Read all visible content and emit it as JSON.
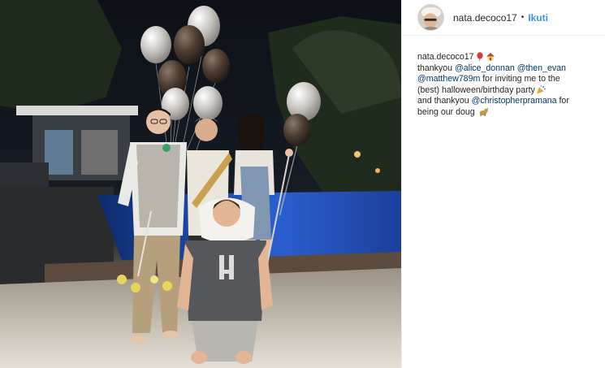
{
  "post": {
    "username": "nata.decoco17",
    "separator": "•",
    "follow_label": "Ikuti"
  },
  "caption": {
    "username": "nata.decoco17",
    "lines": [
      {
        "parts": [
          {
            "t": "text",
            "v": "thankyou "
          },
          {
            "t": "mention",
            "v": "@alice_donnan"
          },
          {
            "t": "text",
            "v": " "
          },
          {
            "t": "mention",
            "v": "@then_evan"
          }
        ]
      },
      {
        "parts": [
          {
            "t": "mention",
            "v": "@matthew789m"
          },
          {
            "t": "text",
            "v": " for inviting me to the"
          }
        ]
      },
      {
        "parts": [
          {
            "t": "text",
            "v": "(best) halloween/birthday party"
          }
        ]
      },
      {
        "parts": [
          {
            "t": "text",
            "v": "and thankyou "
          },
          {
            "t": "mention",
            "v": "@christopherpramana"
          },
          {
            "t": "text",
            "v": " for"
          }
        ]
      },
      {
        "parts": [
          {
            "t": "text",
            "v": "being our doug"
          }
        ]
      }
    ],
    "emojis": [
      "balloon-emoji",
      "house-emoji",
      "party-popper-emoji",
      "dog-emoji"
    ]
  }
}
